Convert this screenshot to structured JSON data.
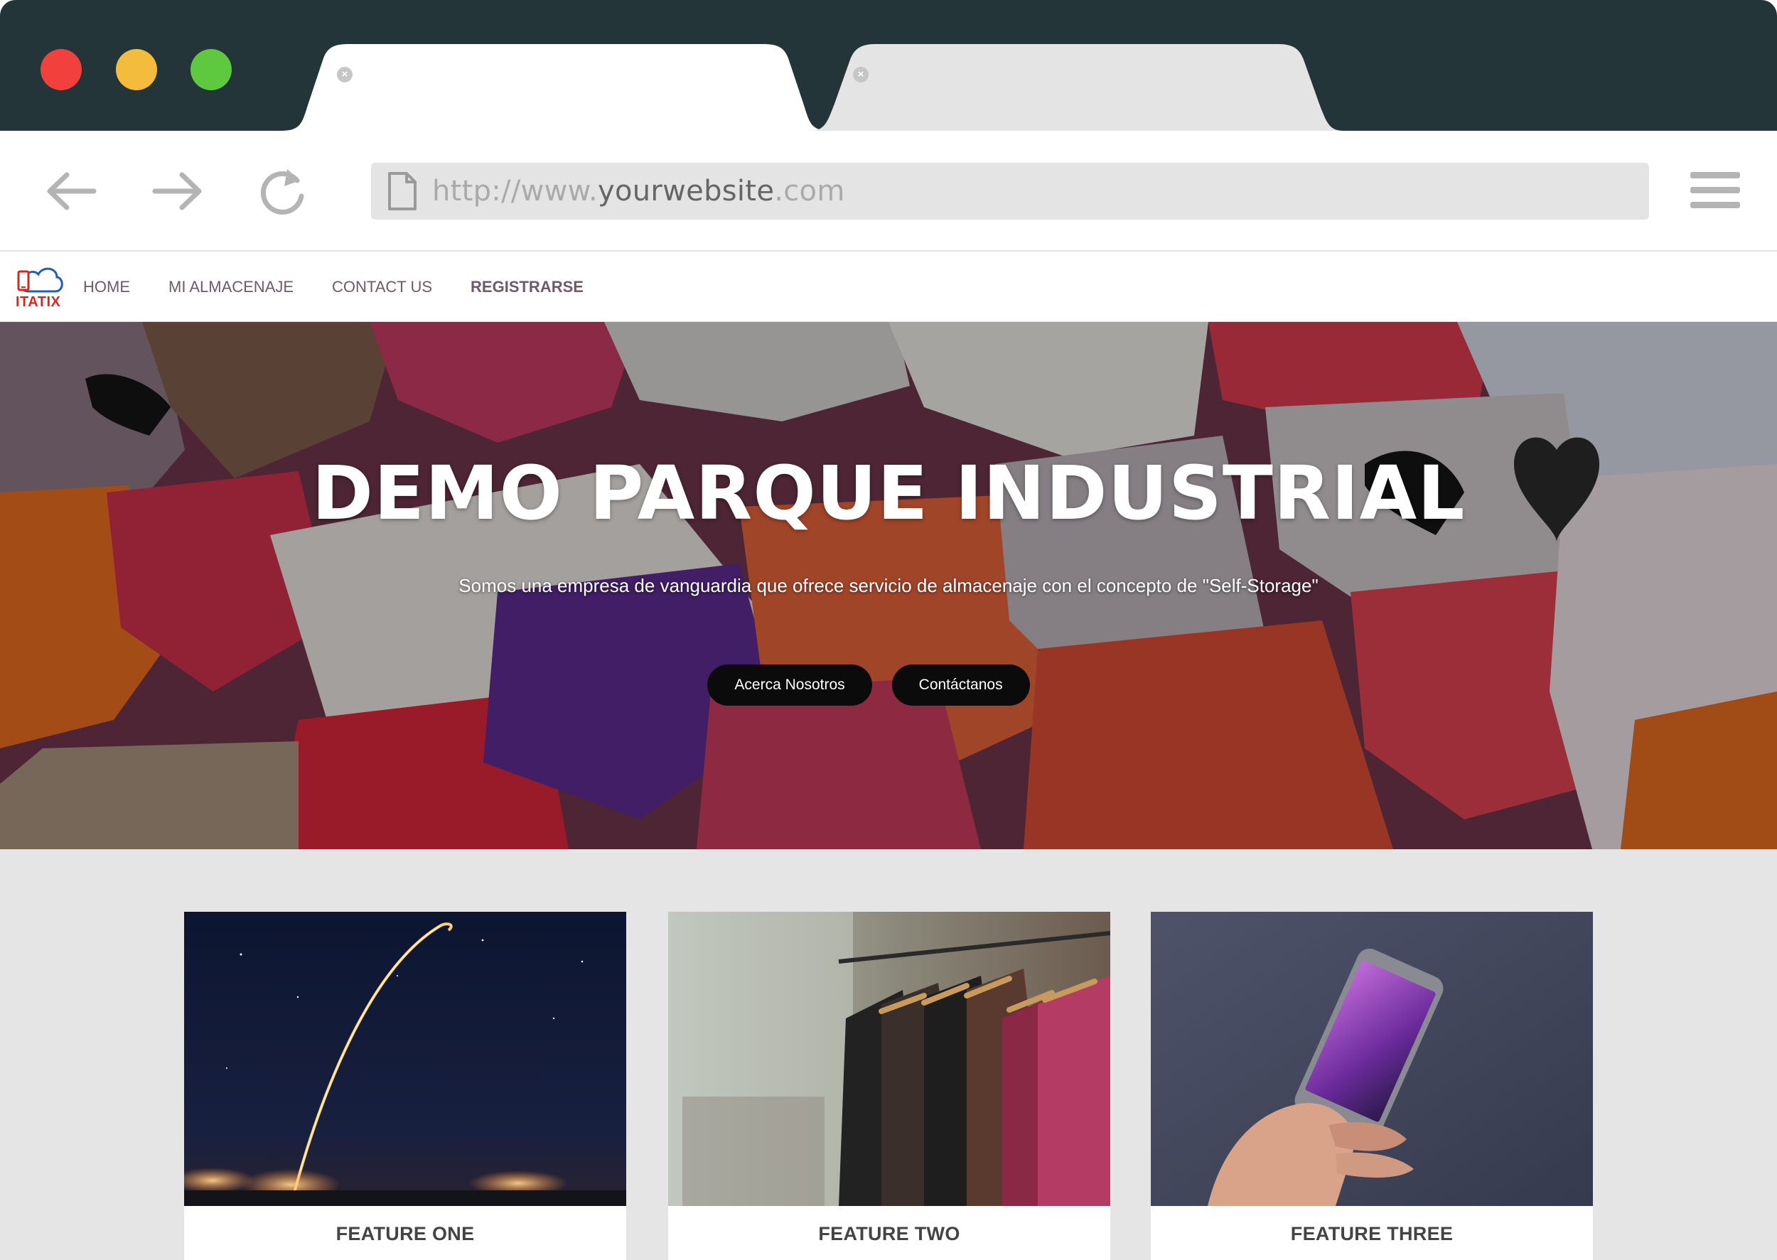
{
  "browser": {
    "url_prefix": "http://www.",
    "url_domain": "yourwebsite",
    "url_suffix": ".com",
    "tab_close_glyph": "×",
    "colors": {
      "titlebar": "#24353a",
      "close": "#f2403d",
      "minimize": "#f4bc3c",
      "maximize": "#5ec83f"
    }
  },
  "site": {
    "logo_text": "ITATIX",
    "nav": [
      {
        "label": "HOME"
      },
      {
        "label": "MI ALMACENAJE"
      },
      {
        "label": "CONTACT US"
      },
      {
        "label": "REGISTRARSE"
      }
    ]
  },
  "hero": {
    "title": "DEMO PARQUE INDUSTRIAL",
    "subtitle": "Somos una empresa de vanguardia que ofrece servicio de almacenaje con el concepto de \"Self-Storage\"",
    "buttons": [
      {
        "label": "Acerca Nosotros"
      },
      {
        "label": "Contáctanos"
      }
    ]
  },
  "features": [
    {
      "title": "FEATURE ONE",
      "image": "rocket-launch-night-sky"
    },
    {
      "title": "FEATURE TWO",
      "image": "clothes-on-hangers-rack"
    },
    {
      "title": "FEATURE THREE",
      "image": "hand-holding-smartphone"
    }
  ]
}
